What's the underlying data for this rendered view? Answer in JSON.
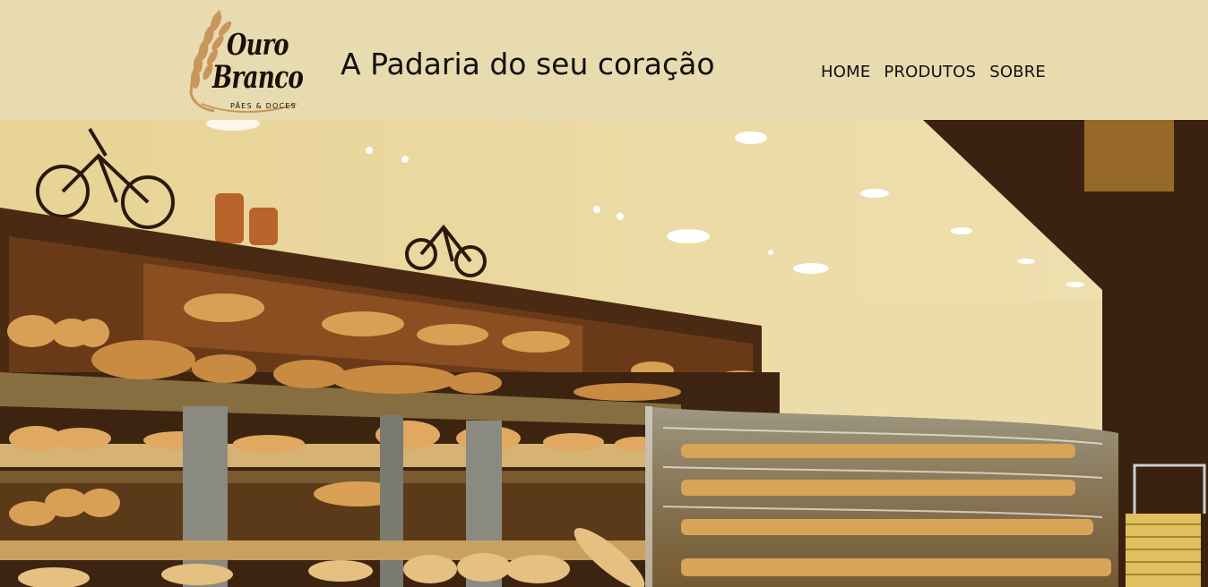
{
  "header": {
    "logo": {
      "word1": "Ouro",
      "word2": "Branco",
      "tagline": "PÃES & DOCES",
      "icon": "wheat-icon"
    },
    "headline": "A Padaria do seu coração",
    "nav": [
      {
        "label": "HOME"
      },
      {
        "label": "PRODUTOS"
      },
      {
        "label": "SOBRE"
      }
    ]
  },
  "hero": {
    "subject": "bakery-display-photo"
  },
  "colors": {
    "header_bg": "#e8dbb0",
    "text": "#111111",
    "wood": "#4a2a12",
    "wall": "#e6cf8e"
  }
}
